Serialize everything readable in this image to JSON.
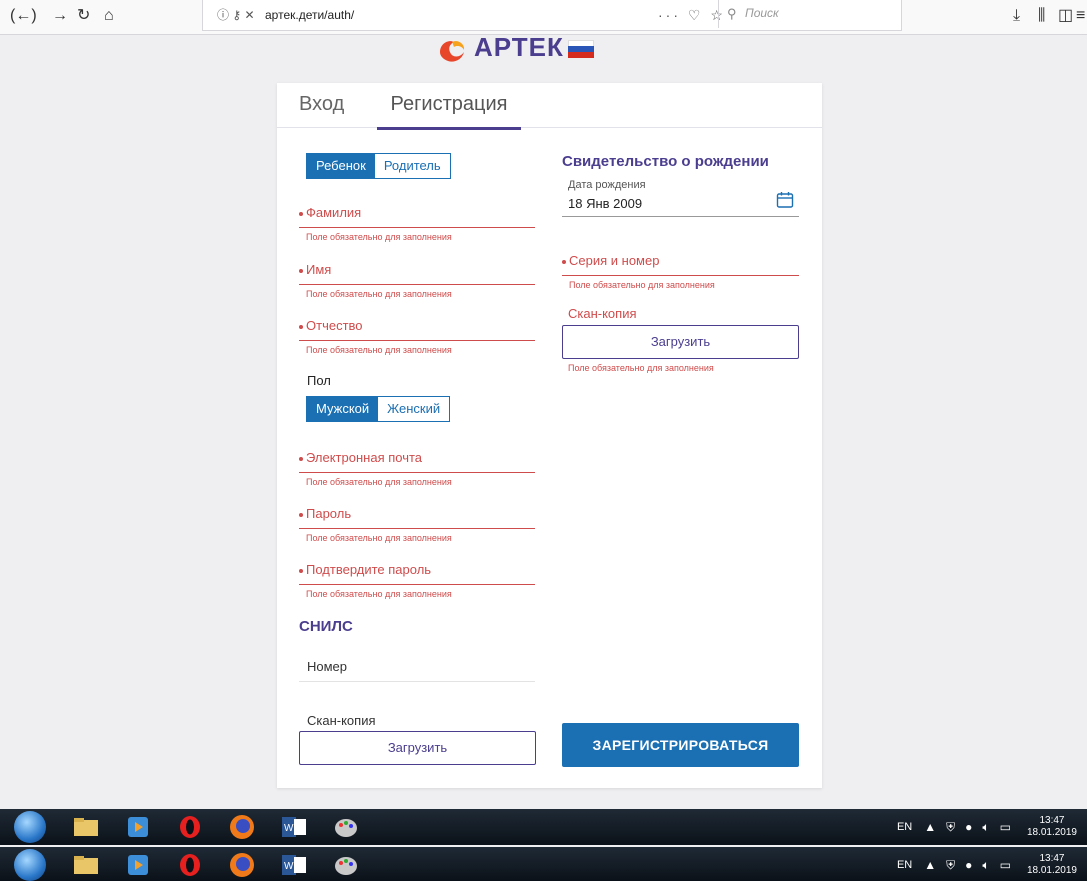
{
  "browser": {
    "url": "артек.дети/auth/",
    "search_placeholder": "Поиск"
  },
  "logo": {
    "text": "АРТЕК"
  },
  "tabs": [
    {
      "label": "Вход",
      "active": false
    },
    {
      "label": "Регистрация",
      "active": true
    }
  ],
  "role_toggle": {
    "options": [
      "Ребенок",
      "Родитель"
    ],
    "selected": "Ребенок"
  },
  "left_fields": [
    {
      "label": "Фамилия",
      "required": true,
      "error": "Поле обязательно для заполнения"
    },
    {
      "label": "Имя",
      "required": true,
      "error": "Поле обязательно для заполнения"
    },
    {
      "label": "Отчество",
      "required": true,
      "error": "Поле обязательно для заполнения"
    }
  ],
  "gender": {
    "label": "Пол",
    "options": [
      "Мужской",
      "Женский"
    ],
    "selected": "Мужской"
  },
  "account_fields": [
    {
      "label": "Электронная почта",
      "required": true,
      "error": "Поле обязательно для заполнения"
    },
    {
      "label": "Пароль",
      "required": true,
      "error": "Поле обязательно для заполнения"
    },
    {
      "label": "Подтвердите пароль",
      "required": true,
      "error": "Поле обязательно для заполнения"
    }
  ],
  "snils": {
    "title": "СНИЛС",
    "number_label": "Номер",
    "scan_label": "Скан-копия",
    "upload_label": "Загрузить"
  },
  "birth_certificate": {
    "title": "Свидетельство о рождении",
    "dob_label": "Дата рождения",
    "dob_value": "18 Янв 2009",
    "series_label": "Серия и номер",
    "series_error": "Поле обязательно для заполнения",
    "scan_label": "Скан-копия",
    "upload_label": "Загрузить",
    "scan_error": "Поле обязательно для заполнения"
  },
  "register_button": "ЗАРЕГИСТРИРОВАТЬСЯ",
  "taskbar": {
    "lang": "EN",
    "time": "13:47",
    "date": "18.01.2019"
  },
  "colors": {
    "brand": "#4b3e8f",
    "primary": "#1b6fb3",
    "error": "#cf4c4c"
  }
}
